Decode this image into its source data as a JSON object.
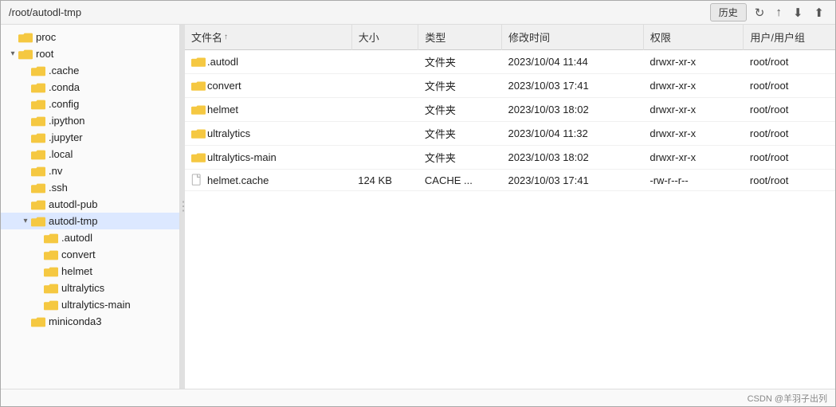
{
  "titlebar": {
    "path": "/root/autodl-tmp",
    "history_btn": "历史",
    "refresh_icon": "↻",
    "up_icon": "↑",
    "download_icon": "⬇",
    "upload_icon": "⬆"
  },
  "sidebar": {
    "items": [
      {
        "id": "proc",
        "label": "proc",
        "indent": 0,
        "expanded": false,
        "selected": false,
        "has_arrow": false
      },
      {
        "id": "root",
        "label": "root",
        "indent": 0,
        "expanded": true,
        "selected": false,
        "has_arrow": true
      },
      {
        "id": "cache",
        "label": ".cache",
        "indent": 1,
        "expanded": false,
        "selected": false,
        "has_arrow": false
      },
      {
        "id": "conda",
        "label": ".conda",
        "indent": 1,
        "expanded": false,
        "selected": false,
        "has_arrow": false
      },
      {
        "id": "config",
        "label": ".config",
        "indent": 1,
        "expanded": false,
        "selected": false,
        "has_arrow": false
      },
      {
        "id": "ipython",
        "label": ".ipython",
        "indent": 1,
        "expanded": false,
        "selected": false,
        "has_arrow": false
      },
      {
        "id": "jupyter",
        "label": ".jupyter",
        "indent": 1,
        "expanded": false,
        "selected": false,
        "has_arrow": false
      },
      {
        "id": "local",
        "label": ".local",
        "indent": 1,
        "expanded": false,
        "selected": false,
        "has_arrow": false
      },
      {
        "id": "nv",
        "label": ".nv",
        "indent": 1,
        "expanded": false,
        "selected": false,
        "has_arrow": false
      },
      {
        "id": "ssh",
        "label": ".ssh",
        "indent": 1,
        "expanded": false,
        "selected": false,
        "has_arrow": false
      },
      {
        "id": "autodl-pub",
        "label": "autodl-pub",
        "indent": 1,
        "expanded": false,
        "selected": false,
        "has_arrow": false
      },
      {
        "id": "autodl-tmp",
        "label": "autodl-tmp",
        "indent": 1,
        "expanded": true,
        "selected": true,
        "has_arrow": true
      },
      {
        "id": "autodl-sub",
        "label": ".autodl",
        "indent": 2,
        "expanded": false,
        "selected": false,
        "has_arrow": false
      },
      {
        "id": "convert-sub",
        "label": "convert",
        "indent": 2,
        "expanded": false,
        "selected": false,
        "has_arrow": false
      },
      {
        "id": "helmet-sub",
        "label": "helmet",
        "indent": 2,
        "expanded": false,
        "selected": false,
        "has_arrow": false
      },
      {
        "id": "ultralytics-sub",
        "label": "ultralytics",
        "indent": 2,
        "expanded": false,
        "selected": false,
        "has_arrow": false
      },
      {
        "id": "ultralytics-main-sub",
        "label": "ultralytics-main",
        "indent": 2,
        "expanded": false,
        "selected": false,
        "has_arrow": false
      },
      {
        "id": "miniconda3",
        "label": "miniconda3",
        "indent": 1,
        "expanded": false,
        "selected": false,
        "has_arrow": false
      }
    ]
  },
  "file_table": {
    "columns": [
      {
        "id": "name",
        "label": "文件名",
        "sort": "asc"
      },
      {
        "id": "size",
        "label": "大小"
      },
      {
        "id": "type",
        "label": "类型"
      },
      {
        "id": "modified",
        "label": "修改时间"
      },
      {
        "id": "perm",
        "label": "权限"
      },
      {
        "id": "owner",
        "label": "用户/用户组"
      }
    ],
    "rows": [
      {
        "name": ".autodl",
        "size": "",
        "type": "文件夹",
        "modified": "2023/10/04 11:44",
        "perm": "drwxr-xr-x",
        "owner": "root/root",
        "is_folder": true
      },
      {
        "name": "convert",
        "size": "",
        "type": "文件夹",
        "modified": "2023/10/03 17:41",
        "perm": "drwxr-xr-x",
        "owner": "root/root",
        "is_folder": true
      },
      {
        "name": "helmet",
        "size": "",
        "type": "文件夹",
        "modified": "2023/10/03 18:02",
        "perm": "drwxr-xr-x",
        "owner": "root/root",
        "is_folder": true
      },
      {
        "name": "ultralytics",
        "size": "",
        "type": "文件夹",
        "modified": "2023/10/04 11:32",
        "perm": "drwxr-xr-x",
        "owner": "root/root",
        "is_folder": true
      },
      {
        "name": "ultralytics-main",
        "size": "",
        "type": "文件夹",
        "modified": "2023/10/03 18:02",
        "perm": "drwxr-xr-x",
        "owner": "root/root",
        "is_folder": true
      },
      {
        "name": "helmet.cache",
        "size": "124 KB",
        "type": "CACHE ...",
        "modified": "2023/10/03 17:41",
        "perm": "-rw-r--r--",
        "owner": "root/root",
        "is_folder": false
      }
    ]
  },
  "statusbar": {
    "text": "CSDN @羊羽子出列"
  }
}
